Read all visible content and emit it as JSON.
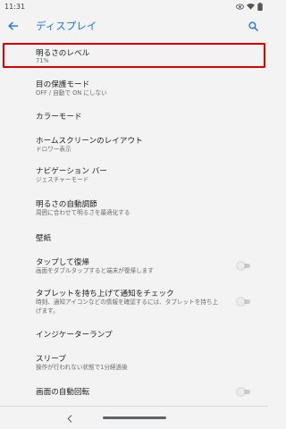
{
  "status_bar": {
    "time": "11:31",
    "icons": [
      "eye-icon",
      "wifi-icon",
      "battery-icon"
    ]
  },
  "app_bar": {
    "title": "ディスプレイ",
    "back_icon": "arrow-left-icon",
    "search_icon": "search-icon",
    "accent_color": "#1a73e8"
  },
  "settings": [
    {
      "title": "明るさのレベル",
      "subtitle": "71%",
      "highlighted": true
    },
    {
      "title": "目の保護モード",
      "subtitle": "OFF / 自動で ON にしない"
    },
    {
      "title": "カラーモード"
    },
    {
      "title": "ホームスクリーンのレイアウト",
      "subtitle": "ドロワー表示"
    },
    {
      "title": "ナビゲーション バー",
      "subtitle": "ジェスチャーモード"
    },
    {
      "title": "明るさの自動調節",
      "subtitle": "周囲に合わせて明るさを最適化する"
    },
    {
      "title": "壁紙"
    },
    {
      "title": "タップして復帰",
      "subtitle": "画面をダブルタップすると端末が復帰します",
      "toggle": false
    },
    {
      "title": "タブレットを持ち上げて通知をチェック",
      "subtitle": "時刻、通知アイコンなどの情報を確認するには、タブレットを持ち上げます。",
      "toggle": false
    },
    {
      "title": "インジケーターランプ"
    },
    {
      "title": "スリープ",
      "subtitle": "操作が行われない状態で1分経過後"
    },
    {
      "title": "画面の自動回転",
      "toggle": false
    }
  ],
  "highlight_color": "#e00000",
  "nav_bar": {
    "back_icon": "chevron-left-icon",
    "home_pill": "home-pill"
  }
}
